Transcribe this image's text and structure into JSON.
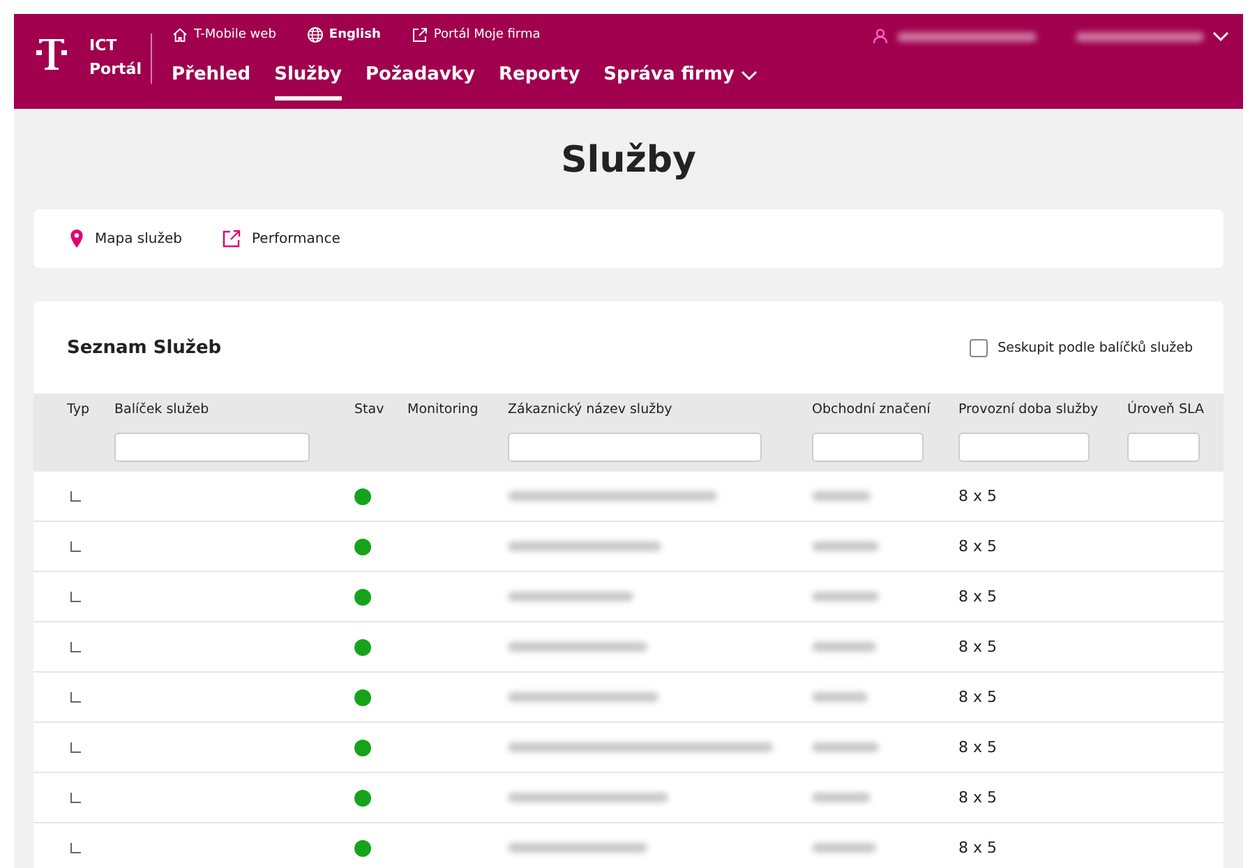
{
  "header": {
    "logo_text": [
      "ICT",
      "Portál"
    ],
    "top_links": [
      {
        "kind": "home",
        "label": "T-Mobile web",
        "bold": false
      },
      {
        "kind": "globe",
        "label": "English",
        "bold": true
      },
      {
        "kind": "external",
        "label": "Portál Moje firma",
        "bold": false
      }
    ],
    "nav": [
      {
        "label": "Přehled",
        "selected": false,
        "dropdown": false
      },
      {
        "label": "Služby",
        "selected": true,
        "dropdown": false
      },
      {
        "label": "Požadavky",
        "selected": false,
        "dropdown": false
      },
      {
        "label": "Reporty",
        "selected": false,
        "dropdown": false
      },
      {
        "label": "Správa firmy",
        "selected": false,
        "dropdown": true
      }
    ]
  },
  "page_title": "Služby",
  "quick_links": [
    {
      "kind": "pin",
      "label": "Mapa služeb"
    },
    {
      "kind": "external",
      "label": "Performance"
    }
  ],
  "list": {
    "title": "Seznam Služeb",
    "group_checkbox": {
      "label": "Seskupit podle balíčků služeb",
      "checked": false
    },
    "columns": [
      {
        "label": "Typ",
        "filter": false
      },
      {
        "label": "Balíček služeb",
        "filter": true
      },
      {
        "label": "Stav",
        "filter": false
      },
      {
        "label": "Monitoring",
        "filter": false
      },
      {
        "label": "Zákaznický název služby",
        "filter": true
      },
      {
        "label": "Obchodní značení",
        "filter": true
      },
      {
        "label": "Provozní doba služby",
        "filter": true
      },
      {
        "label": "Úroveň SLA",
        "filter": true
      }
    ],
    "rows": [
      {
        "color": "#16a31a",
        "hours": "8 x 5"
      },
      {
        "color": "#16a31a",
        "hours": "8 x 5"
      },
      {
        "color": "#16a31a",
        "hours": "8 x 5"
      },
      {
        "color": "#16a31a",
        "hours": "8 x 5"
      },
      {
        "color": "#16a31a",
        "hours": "8 x 5"
      },
      {
        "color": "#16a31a",
        "hours": "8 x 5"
      },
      {
        "color": "#16a31a",
        "hours": "8 x 5"
      },
      {
        "color": "#16a31a",
        "hours": "8 x 5"
      }
    ]
  }
}
